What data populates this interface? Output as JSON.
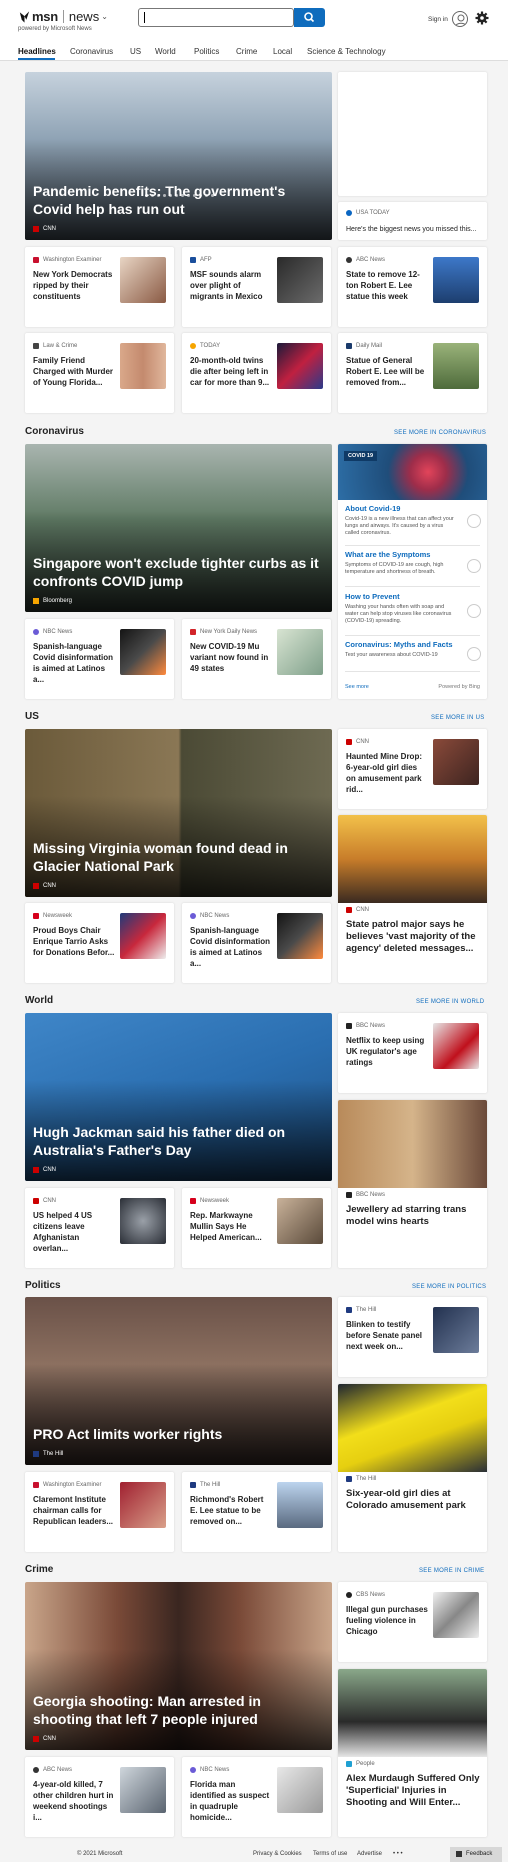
{
  "header": {
    "brand": "msn",
    "section": "news",
    "powered_by": "powered by Microsoft News",
    "search": {
      "value": "",
      "placeholder": ""
    },
    "sign_in": "Sign in"
  },
  "nav": {
    "tabs": [
      "Headlines",
      "Coronavirus",
      "US",
      "World",
      "Politics",
      "Crime",
      "Local",
      "Science & Technology"
    ]
  },
  "top": {
    "hero": {
      "title": "Pandemic benefits: The government's Covid help has run out",
      "source": "CNN"
    },
    "side": {
      "source": "USA TODAY",
      "title": "Here's the biggest news you missed this..."
    },
    "cards": [
      {
        "source": "Washington Examiner",
        "title": "New York Democrats ripped by their constituents"
      },
      {
        "source": "AFP",
        "title": "MSF sounds alarm over plight of migrants in Mexico"
      },
      {
        "source": "ABC News",
        "title": "State to remove 12-ton Robert E. Lee statue this week"
      },
      {
        "source": "Law & Crime",
        "title": "Family Friend Charged with Murder of Young Florida..."
      },
      {
        "source": "TODAY",
        "title": "20-month-old twins die after being left in car for more than 9..."
      },
      {
        "source": "Daily Mail",
        "title": "Statue of General Robert E. Lee will be removed from..."
      }
    ]
  },
  "coronavirus": {
    "heading": "Coronavirus",
    "see_more": "SEE MORE IN CORONAVIRUS",
    "hero": {
      "title": "Singapore won't exclude tighter curbs as it confronts COVID jump",
      "source": "Bloomberg"
    },
    "cards": [
      {
        "source": "NBC News",
        "title": "Spanish-language Covid disinformation is aimed at Latinos a..."
      },
      {
        "source": "New York Daily News",
        "title": "New COVID-19 Mu variant now found in 49 states"
      }
    ],
    "panel": {
      "badge": "COVID 19",
      "items": [
        {
          "q": "About Covid-19",
          "a": "Covid-19 is a new illness that can affect your lungs and airways. It's caused by a virus called coronavirus."
        },
        {
          "q": "What are the Symptoms",
          "a": "Symptoms of COVID-19 are cough, high temperature and shortness of breath."
        },
        {
          "q": "How to Prevent",
          "a": "Washing your hands often with soap and water can help stop viruses like coronavirus (COVID-19) spreading."
        },
        {
          "q": "Coronavirus: Myths and Facts",
          "a": "Test your awareness about COVID-19"
        }
      ],
      "see_more": "See more",
      "powered": "Powered by Bing"
    }
  },
  "us": {
    "heading": "US",
    "see_more": "SEE MORE IN US",
    "hero": {
      "title": "Missing Virginia woman found dead in Glacier National Park",
      "source": "CNN"
    },
    "side": {
      "source": "CNN",
      "title": "Haunted Mine Drop: 6-year-old girl dies on amusement park rid..."
    },
    "side_img": {
      "source": "CNN",
      "title": "State patrol major says he believes 'vast majority of the agency' deleted messages..."
    },
    "cards": [
      {
        "source": "Newsweek",
        "title": "Proud Boys Chair Enrique Tarrio Asks for Donations Befor..."
      },
      {
        "source": "NBC News",
        "title": "Spanish-language Covid disinformation is aimed at Latinos a..."
      }
    ]
  },
  "world": {
    "heading": "World",
    "see_more": "SEE MORE IN WORLD",
    "hero": {
      "title": "Hugh Jackman said his father died on Australia's Father's Day",
      "source": "CNN"
    },
    "side": {
      "source": "BBC News",
      "title": "Netflix to keep using UK regulator's age ratings"
    },
    "side_img": {
      "source": "BBC News",
      "title": "Jewellery ad starring trans model wins hearts"
    },
    "cards": [
      {
        "source": "CNN",
        "title": "US helped 4 US citizens leave Afghanistan overlan..."
      },
      {
        "source": "Newsweek",
        "title": "Rep. Markwayne Mullin Says He Helped American..."
      }
    ]
  },
  "politics": {
    "heading": "Politics",
    "see_more": "SEE MORE IN POLITICS",
    "hero": {
      "title": "PRO Act limits worker rights",
      "source": "The Hill"
    },
    "side": {
      "source": "The Hill",
      "title": "Blinken to testify before Senate panel next week on..."
    },
    "side_img": {
      "source": "The Hill",
      "title": "Six-year-old girl dies at Colorado amusement park"
    },
    "cards": [
      {
        "source": "Washington Examiner",
        "title": "Claremont Institute chairman calls for Republican leaders..."
      },
      {
        "source": "The Hill",
        "title": "Richmond's Robert E. Lee statue to be removed on..."
      }
    ]
  },
  "crime": {
    "heading": "Crime",
    "see_more": "SEE MORE IN CRIME",
    "hero": {
      "title": "Georgia shooting: Man arrested in shooting that left 7 people injured",
      "source": "CNN"
    },
    "side": {
      "source": "CBS News",
      "title": "Illegal gun purchases fueling violence in Chicago"
    },
    "side_img": {
      "source": "People",
      "title": "Alex Murdaugh Suffered Only 'Superficial' Injuries in Shooting and Will Enter..."
    },
    "cards": [
      {
        "source": "ABC News",
        "title": "4-year-old killed, 7 other children hurt in weekend shootings i..."
      },
      {
        "source": "NBC News",
        "title": "Florida man identified as suspect in quadruple homicide..."
      }
    ]
  },
  "footer": {
    "copyright": "© 2021 Microsoft",
    "links": [
      "Privacy & Cookies",
      "Terms of use",
      "Advertise"
    ],
    "more": "• • •",
    "feedback": "Feedback"
  }
}
